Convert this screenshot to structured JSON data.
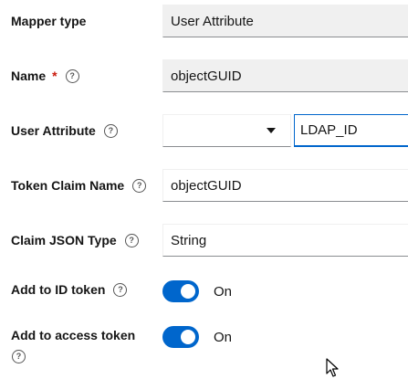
{
  "form": {
    "mapper_type": {
      "label": "Mapper type",
      "value": "User Attribute"
    },
    "name": {
      "label": "Name",
      "required_mark": "*",
      "value": "objectGUID"
    },
    "user_attribute": {
      "label": "User Attribute",
      "select_value": "",
      "value": "LDAP_ID"
    },
    "token_claim_name": {
      "label": "Token Claim Name",
      "value": "objectGUID"
    },
    "claim_json_type": {
      "label": "Claim JSON Type",
      "value": "String"
    },
    "add_to_id_token": {
      "label": "Add to ID token",
      "state_label": "On",
      "on": true
    },
    "add_to_access_token": {
      "label": "Add to access token",
      "state_label": "On",
      "on": true
    }
  },
  "icons": {
    "help": "question-circle-icon",
    "caret": "caret-down-icon",
    "cursor": "mouse-pointer-icon"
  },
  "colors": {
    "accent": "#0066cc",
    "required": "#c9190b",
    "readonly_bg": "#f0f0f0"
  }
}
